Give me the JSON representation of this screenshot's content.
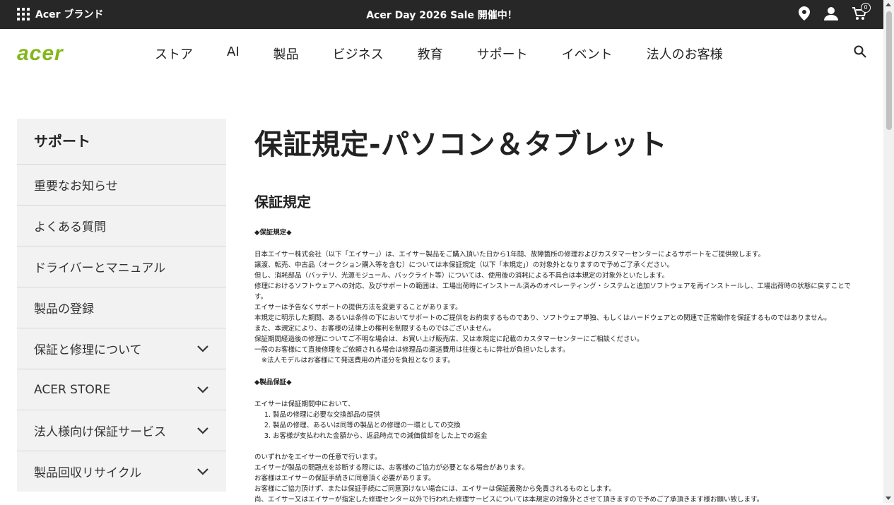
{
  "topbar": {
    "brand_label": "Acer ブランド",
    "promo": "Acer Day 2026 Sale 開催中！",
    "cart_count": "0"
  },
  "nav": {
    "logo": "acer",
    "items": [
      "ストア",
      "AI",
      "製品",
      "ビジネス",
      "教育",
      "サポート",
      "イベント",
      "法人のお客様"
    ]
  },
  "sidebar": {
    "title": "サポート",
    "items": [
      {
        "label": "重要なお知らせ"
      },
      {
        "label": "よくある質問"
      },
      {
        "label": "ドライバーとマニュアル"
      },
      {
        "label": "製品の登録"
      },
      {
        "label": "保証と修理について"
      },
      {
        "label": "ACER STORE"
      },
      {
        "label": "法人様向け保証サービス"
      },
      {
        "label": "製品回収リサイクル"
      }
    ]
  },
  "main": {
    "title": "保証規定-パソコン＆タブレット",
    "subtitle": "保証規定",
    "section1": {
      "heading": "◆保証規定◆",
      "lines": [
        "日本エイサー株式会社（以下「エイサー」）は、エイサー製品をご購入頂いた日から1年間、故障箇所の修理およびカスタマーセンターによるサポートをご提供致します。",
        "譲渡、転売、中古品（オークション購入等を含む）については本保証規定（以下「本規定」）の対象外となりますので予めご了承ください。",
        "但し、消耗部品（バッテリ、光源モジュール、バックライト等）については、使用後の消耗による不具合は本規定の対象外といたします。",
        "修理におけるソフトウェアへの対応、及びサポートの範囲は、工場出荷時にインストール済みのオペレーティング・システムと追加ソフトウェアを再インストールし、工場出荷時の状態に戻すことです。",
        "エイサーは予告なくサポートの提供方法を変更することがあります。",
        "本規定に明示した期間、あるいは条件の下においてサポートのご提供をお約束するものであり、ソフトウェア単独、もしくはハードウェアとの関連で正常動作を保証するものではありません。",
        "また、本規定により、お客様の法律上の権利を制限するものではございません。",
        "保証期間経過後の修理についてご不明な場合は、お買い上げ販売店、又は本規定に記載のカスタマーセンターにご相談ください。",
        "一般のお客様にて直接修理をご依頼される場合は修理品の運送費用は往復ともに弊社が負担いたします。"
      ],
      "note": "※法人モデルはお客様にて発送費用の片道分を負担となります。"
    },
    "section2": {
      "heading": "◆製品保証◆",
      "intro": "エイサーは保証期間中において、",
      "list": [
        "製品の修理に必要な交換部品の提供",
        "製品の修理、あるいは同等の製品との修理の一環としての交換",
        "お客様が支払われた金額から、返品時点での減価償却をした上での返金"
      ],
      "after": [
        "のいずれかをエイサーの任意で行います。",
        "エイサーが製品の問題点を診断する際には、お客様のご協力が必要となる場合があります。",
        "お客様はエイサーの保証手続きに同意頂く必要があります。",
        "お客様にご協力頂けず、または保証手続にご同意頂けない場合には、エイサーは保証義務から免責されるものとします。",
        "尚、エイサー又はエイサーが指定した修理センター以外で行われた修理サービスについては本規定の対象外とさせて頂きますので予めご了承頂きます様お願い致します。"
      ]
    }
  }
}
